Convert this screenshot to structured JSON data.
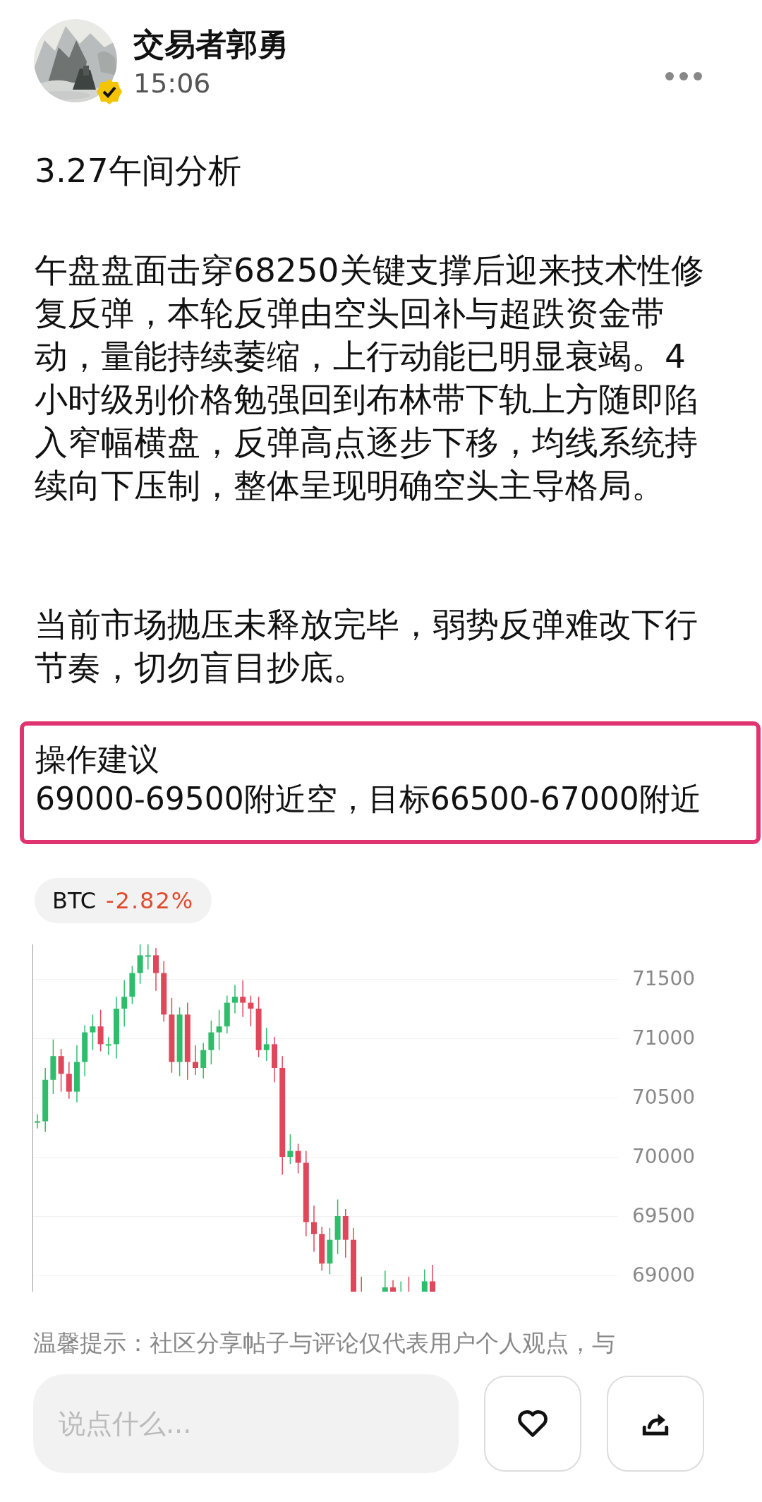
{
  "author": {
    "name": "交易者郭勇",
    "time": "15:06"
  },
  "post": {
    "title": "3.27午间分析",
    "paragraphs": [
      "午盘盘面击穿68250关键支撑后迎来技术性修复反弹，本轮反弹由空头回补与超跌资金带动，量能持续萎缩，上行动能已明显衰竭。4小时级别价格勉强回到布林带下轨上方随即陷入窄幅横盘，反弹高点逐步下移，均线系统持续向下压制，整体呈现明确空头主导格局。",
      "当前市场抛压未释放完毕，弱势反弹难改下行节奏，切勿盲目抄底。"
    ],
    "advice": {
      "title": "操作建议",
      "text": "69000-69500附近空，目标66500-67000附近"
    }
  },
  "ticker": {
    "symbol": "BTC",
    "change": "-2.82%"
  },
  "chart": {
    "y_axis_labels": [
      "71500",
      "71000",
      "70500",
      "70000",
      "69500",
      "69000"
    ]
  },
  "disclaimer": "温馨提示：社区分享帖子与评论仅代表用户个人观点，与",
  "comment": {
    "placeholder": "说点什么..."
  }
}
